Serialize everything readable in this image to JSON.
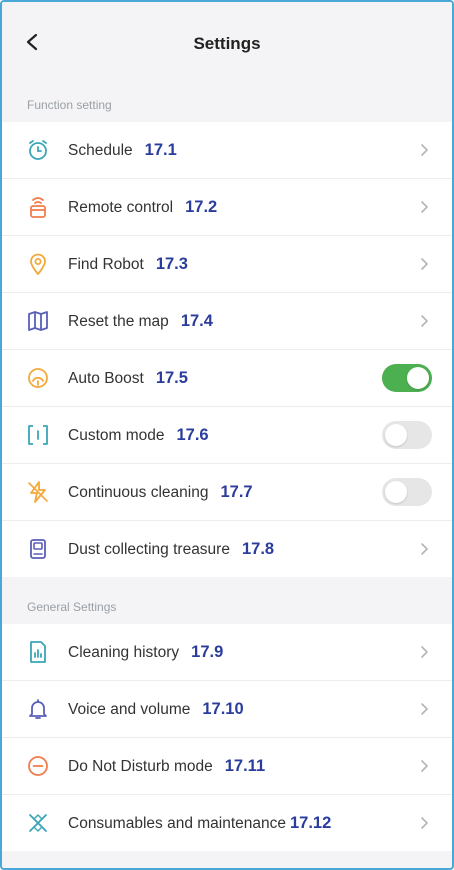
{
  "header": {
    "title": "Settings",
    "back_icon": "chevron-left-icon"
  },
  "sections": [
    {
      "label": "Function setting",
      "items": [
        {
          "label": "Schedule",
          "ref": "17.1",
          "icon": "alarm-clock-icon",
          "control": "chevron"
        },
        {
          "label": "Remote control",
          "ref": "17.2",
          "icon": "remote-signal-icon",
          "control": "chevron"
        },
        {
          "label": "Find Robot",
          "ref": "17.3",
          "icon": "location-pin-icon",
          "control": "chevron"
        },
        {
          "label": "Reset the map",
          "ref": "17.4",
          "icon": "map-icon",
          "control": "chevron"
        },
        {
          "label": "Auto Boost",
          "ref": "17.5",
          "icon": "gauge-icon",
          "control": "toggle",
          "toggle_on": true
        },
        {
          "label": "Custom mode",
          "ref": "17.6",
          "icon": "custom-mode-icon",
          "control": "toggle",
          "toggle_on": false
        },
        {
          "label": "Continuous cleaning",
          "ref": "17.7",
          "icon": "lightning-icon",
          "control": "toggle",
          "toggle_on": false
        },
        {
          "label": "Dust collecting treasure",
          "ref": "17.8",
          "icon": "dust-bin-icon",
          "control": "chevron"
        }
      ]
    },
    {
      "label": "General Settings",
      "items": [
        {
          "label": "Cleaning history",
          "ref": "17.9",
          "icon": "history-chart-icon",
          "control": "chevron"
        },
        {
          "label": "Voice and volume",
          "ref": "17.10",
          "icon": "bell-icon",
          "control": "chevron"
        },
        {
          "label": "Do Not Disturb mode",
          "ref": "17.11",
          "icon": "do-not-disturb-icon",
          "control": "chevron"
        },
        {
          "label": "Consumables and maintenance",
          "ref": "17.12",
          "icon": "consumables-icon",
          "control": "chevron"
        }
      ]
    }
  ],
  "colors": {
    "frame_border": "#4aa8d6",
    "ref_number": "#2b3d9c",
    "toggle_on": "#4caf50",
    "toggle_off": "#e6e6e6",
    "icon_teal": "#3aa6b8",
    "icon_orange": "#f07d4a",
    "icon_amber": "#f3a93a",
    "icon_indigo": "#5a5fb8"
  }
}
